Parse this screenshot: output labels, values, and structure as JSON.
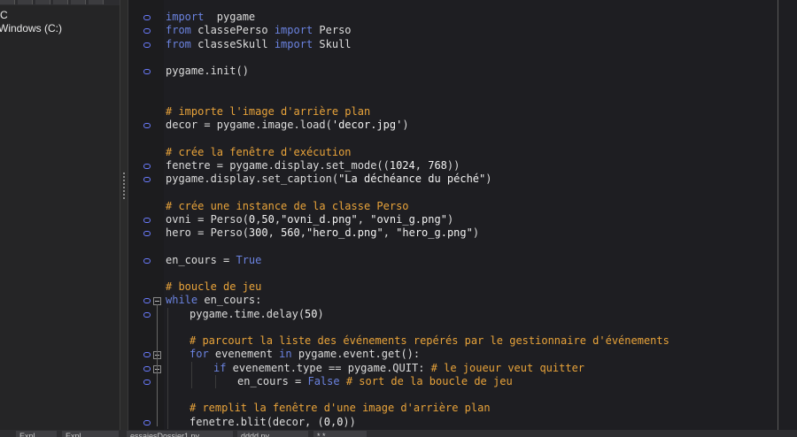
{
  "explorer": {
    "items": [
      {
        "label": "C"
      },
      {
        "label": "Windows (C:)"
      }
    ]
  },
  "editor": {
    "lines": [
      {
        "row": 0,
        "indent": 0,
        "tokens": [
          [
            "kw",
            "import"
          ],
          [
            "",
            "  pygame"
          ]
        ]
      },
      {
        "row": 1,
        "indent": 0,
        "tokens": [
          [
            "kw",
            "from"
          ],
          [
            "",
            " classePerso "
          ],
          [
            "kw",
            "import"
          ],
          [
            "",
            " Perso"
          ]
        ]
      },
      {
        "row": 2,
        "indent": 0,
        "tokens": [
          [
            "kw",
            "from"
          ],
          [
            "",
            " classeSkull "
          ],
          [
            "kw",
            "import"
          ],
          [
            "",
            " Skull"
          ]
        ]
      },
      {
        "row": 4,
        "indent": 0,
        "tokens": [
          [
            "",
            "pygame.init()"
          ]
        ]
      },
      {
        "row": 7,
        "indent": 0,
        "tokens": [
          [
            "cm",
            "# importe l'image d'arrière plan"
          ]
        ]
      },
      {
        "row": 8,
        "indent": 0,
        "tokens": [
          [
            "",
            "decor = pygame.image.load("
          ],
          [
            "str",
            "'decor.jpg'"
          ],
          [
            "",
            ")"
          ]
        ]
      },
      {
        "row": 10,
        "indent": 0,
        "tokens": [
          [
            "cm",
            "# crée la fenêtre d'exécution"
          ]
        ]
      },
      {
        "row": 11,
        "indent": 0,
        "tokens": [
          [
            "",
            "fenetre = pygame.display.set_mode(("
          ],
          [
            "num",
            "1024"
          ],
          [
            "",
            ", "
          ],
          [
            "num",
            "768"
          ],
          [
            "",
            "))"
          ]
        ]
      },
      {
        "row": 12,
        "indent": 0,
        "tokens": [
          [
            "",
            "pygame.display.set_caption("
          ],
          [
            "str",
            "\"La déchéance du péché\""
          ],
          [
            "",
            ")"
          ]
        ]
      },
      {
        "row": 14,
        "indent": 0,
        "tokens": [
          [
            "cm",
            "# crée une instance de la classe Perso"
          ]
        ]
      },
      {
        "row": 15,
        "indent": 0,
        "tokens": [
          [
            "",
            "ovni = Perso("
          ],
          [
            "num",
            "0"
          ],
          [
            "",
            ","
          ],
          [
            "num",
            "50"
          ],
          [
            "",
            ","
          ],
          [
            "str",
            "\"ovni_d.png\""
          ],
          [
            "",
            ", "
          ],
          [
            "str",
            "\"ovni_g.png\""
          ],
          [
            "",
            ")"
          ]
        ]
      },
      {
        "row": 16,
        "indent": 0,
        "tokens": [
          [
            "",
            "hero = Perso("
          ],
          [
            "num",
            "300"
          ],
          [
            "",
            ", "
          ],
          [
            "num",
            "560"
          ],
          [
            "",
            ","
          ],
          [
            "str",
            "\"hero_d.png\""
          ],
          [
            "",
            ", "
          ],
          [
            "str",
            "\"hero_g.png\""
          ],
          [
            "",
            ")"
          ]
        ]
      },
      {
        "row": 18,
        "indent": 0,
        "tokens": [
          [
            "",
            "en_cours = "
          ],
          [
            "kw",
            "True"
          ]
        ]
      },
      {
        "row": 20,
        "indent": 0,
        "tokens": [
          [
            "cm",
            "# boucle de jeu"
          ]
        ]
      },
      {
        "row": 21,
        "indent": 0,
        "tokens": [
          [
            "kw",
            "while"
          ],
          [
            "",
            " en_cours:"
          ]
        ]
      },
      {
        "row": 22,
        "indent": 1,
        "tokens": [
          [
            "",
            "pygame.time.delay("
          ],
          [
            "num",
            "50"
          ],
          [
            "",
            ")"
          ]
        ]
      },
      {
        "row": 24,
        "indent": 1,
        "tokens": [
          [
            "cm",
            "# parcourt la liste des événements repérés par le gestionnaire d'événements"
          ]
        ]
      },
      {
        "row": 25,
        "indent": 1,
        "tokens": [
          [
            "kw",
            "for"
          ],
          [
            "",
            " evenement "
          ],
          [
            "kw",
            "in"
          ],
          [
            "",
            " pygame.event.get():"
          ]
        ]
      },
      {
        "row": 26,
        "indent": 2,
        "tokens": [
          [
            "kw",
            "if"
          ],
          [
            "",
            " evenement.type == pygame.QUIT: "
          ],
          [
            "cm",
            "# le joueur veut quitter"
          ]
        ]
      },
      {
        "row": 27,
        "indent": 3,
        "tokens": [
          [
            "",
            "en_cours = "
          ],
          [
            "kw",
            "False"
          ],
          [
            "",
            " "
          ],
          [
            "cm",
            "# sort de la boucle de jeu"
          ]
        ]
      },
      {
        "row": 29,
        "indent": 1,
        "tokens": [
          [
            "cm",
            "# remplit la fenêtre d'une image d'arrière plan"
          ]
        ]
      },
      {
        "row": 30,
        "indent": 1,
        "tokens": [
          [
            "",
            "fenetre.blit(decor, ("
          ],
          [
            "num",
            "0"
          ],
          [
            "",
            ","
          ],
          [
            "num",
            "0"
          ],
          [
            "",
            "))"
          ]
        ]
      }
    ],
    "bookmark_rows": [
      1,
      2,
      3,
      5,
      9,
      12,
      13,
      16,
      17,
      19,
      22,
      23,
      26,
      27,
      28,
      31
    ],
    "fold_rows": [
      22,
      26,
      27
    ]
  },
  "bottom_tabs": [
    {
      "label": "Expl"
    },
    {
      "label": "Expl"
    },
    {
      "label": "essaiesDossier1.py"
    },
    {
      "label": "dddd.py"
    },
    {
      "label": "* *"
    }
  ],
  "colors": {
    "keyword": "#6b83e0",
    "comment": "#e8a33a",
    "text": "#dcdcdc",
    "bookmark": "#6b7cff"
  }
}
